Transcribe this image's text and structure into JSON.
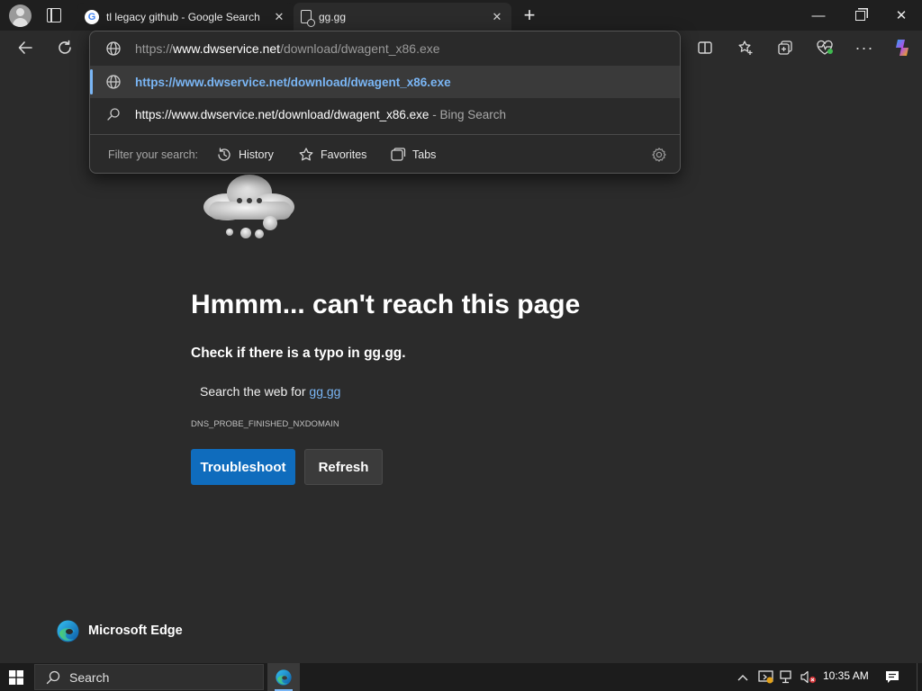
{
  "browser": {
    "tabs": [
      {
        "title": "tl legacy github - Google Search",
        "icon": "google-g-icon"
      },
      {
        "title": "gg.gg",
        "icon": "page-error-icon"
      }
    ]
  },
  "omnibox": {
    "input_prefix": "https://",
    "input_domain": "www.dwservice.net",
    "input_path": "/download/dwagent_x86.exe",
    "suggestions": [
      {
        "text": "https://www.dwservice.net/download/dwagent_x86.exe",
        "icon": "globe-icon"
      },
      {
        "text": "https://www.dwservice.net/download/dwagent_x86.exe",
        "suffix": " - Bing Search",
        "icon": "search-icon"
      }
    ],
    "filter_label": "Filter your search:",
    "filters": [
      "History",
      "Favorites",
      "Tabs"
    ]
  },
  "error_page": {
    "heading": "Hmmm... can't reach this page",
    "subheading": "Check if there is a typo in gg.gg.",
    "search_prefix": "Search the web for ",
    "search_link": "gg gg",
    "error_code": "DNS_PROBE_FINISHED_NXDOMAIN",
    "troubleshoot_label": "Troubleshoot",
    "refresh_label": "Refresh",
    "brand": "Microsoft Edge"
  },
  "taskbar": {
    "search_label": "Search",
    "time": "10:35 AM"
  },
  "colors": {
    "accent": "#0f6cbd",
    "link": "#7ab6f5",
    "background": "#2b2b2b"
  }
}
